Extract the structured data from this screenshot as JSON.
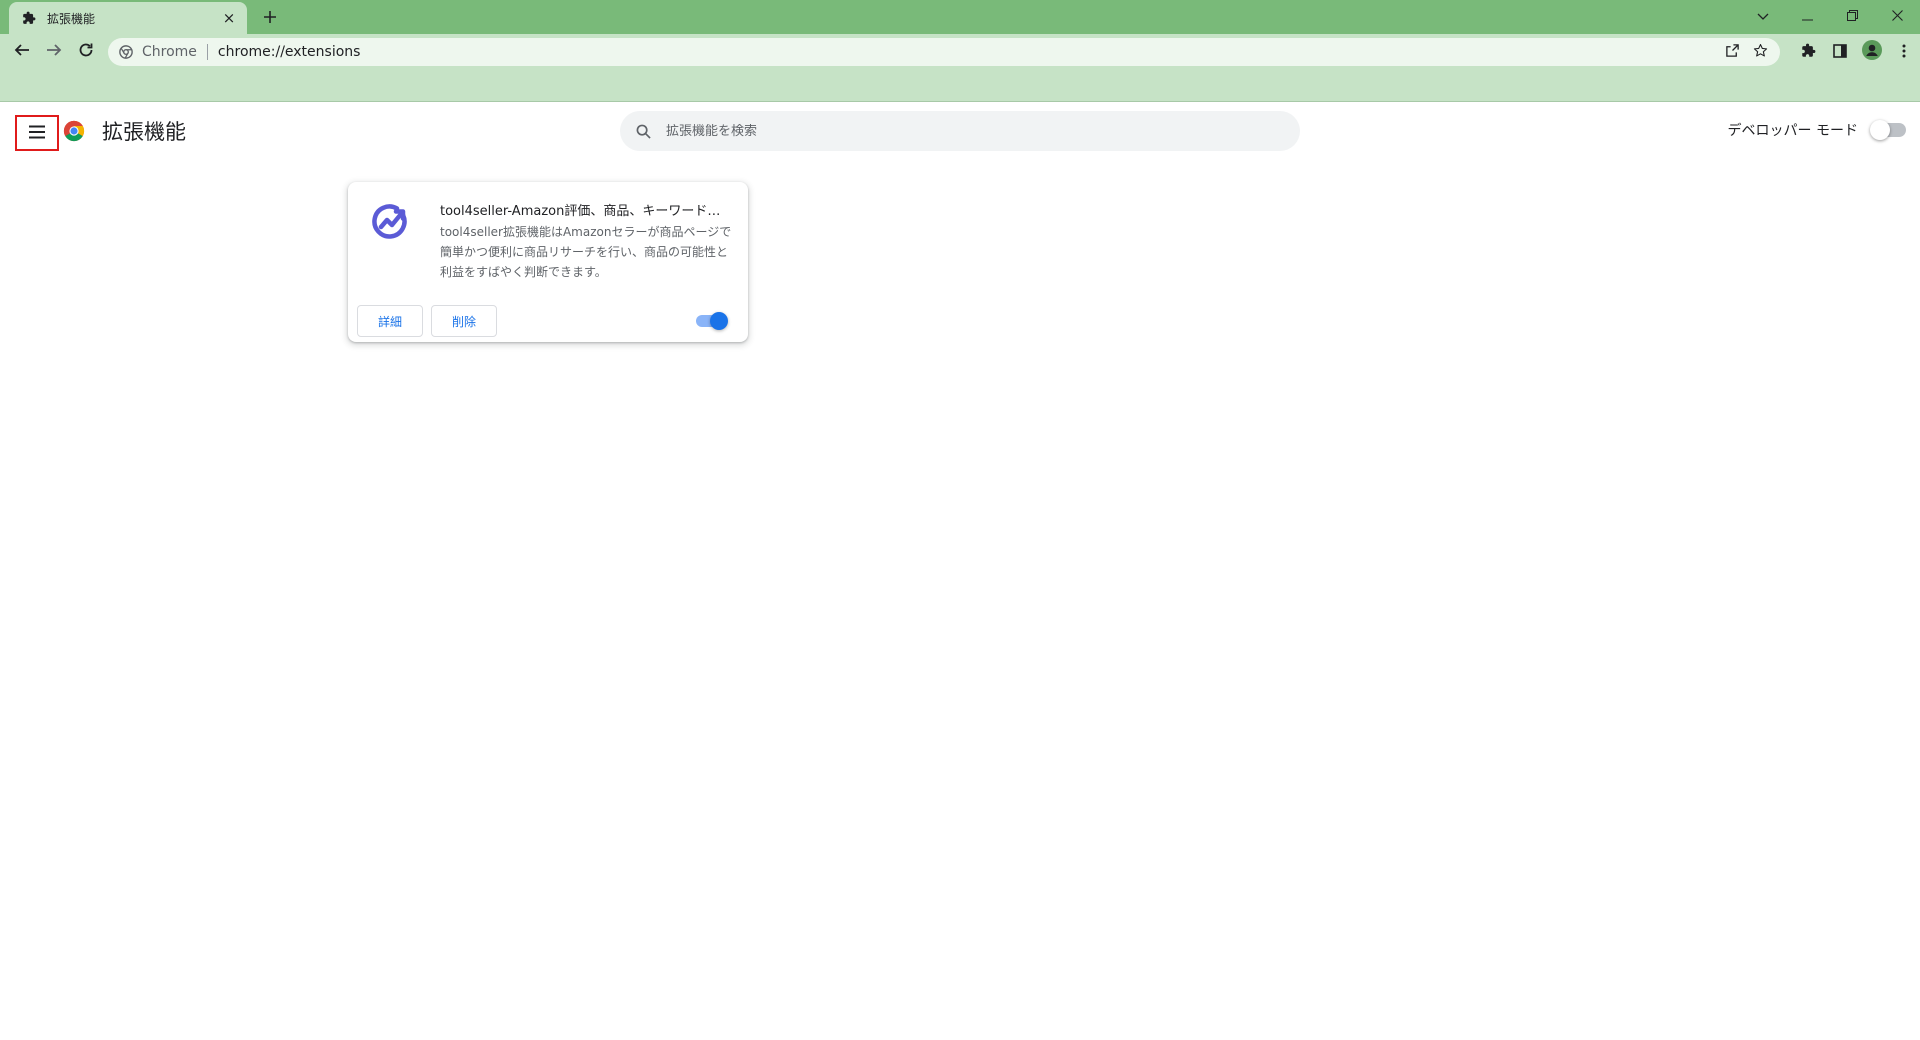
{
  "browser": {
    "tab": {
      "title": "拡張機能",
      "icon": "puzzle-icon",
      "close": "×"
    },
    "window_controls": [
      "chevron-down-icon",
      "minimize-icon",
      "restore-icon",
      "close-icon"
    ],
    "omnibox": {
      "chip": "Chrome",
      "url": "chrome://extensions"
    },
    "toolbar_icons": [
      "back-icon",
      "forward-icon",
      "reload-icon",
      "share-icon",
      "star-icon",
      "extensions-icon",
      "side-panel-icon",
      "profile-icon",
      "more-icon"
    ]
  },
  "page": {
    "title": "拡張機能",
    "search": {
      "placeholder": "拡張機能を検索",
      "value": ""
    },
    "developer_mode": {
      "label": "デベロッパー モード",
      "enabled": false
    }
  },
  "extensions": [
    {
      "name": "tool4seller-Amazon評価、商品、キーワード研...",
      "description": "tool4seller拡張機能はAmazonセラーが商品ページで簡単かつ便利に商品リサーチを行い、商品の可能性と利益をすばやく判断できます。",
      "details_label": "詳細",
      "remove_label": "削除",
      "enabled": true,
      "icon": "trend-chart-icon"
    }
  ],
  "colors": {
    "tabstrip": "#79ba79",
    "toolbar": "#c6e3c6",
    "accent": "#1a73e8",
    "extension_icon": "#5b5bd6",
    "highlight_border": "#e01b1b"
  }
}
